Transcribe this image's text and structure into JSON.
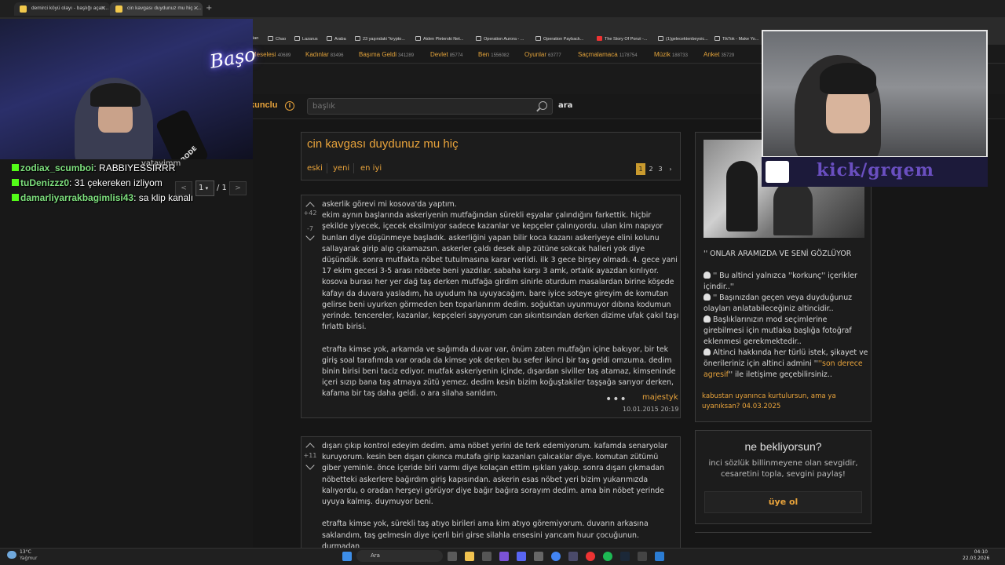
{
  "browser": {
    "tabs": [
      {
        "label": "demirci köyü olayı - başlığı açan..."
      },
      {
        "label": "cin kavgası duydunuz mu hiç - ..."
      }
    ],
    "bookmarks": [
      "ian",
      "Chao",
      "Lazarus",
      "Araba",
      "23 yaşındaki \"krypto...",
      "Aiden Pleterski Net...",
      "Operation Aurora - ...",
      "Operation Payback...",
      "The Story Of Ponzi -...",
      "(1)gelecektenbeyoic...",
      "TikTok - Make Yo..."
    ]
  },
  "site": {
    "categories": [
      {
        "name": "Meselesi",
        "count": "40689"
      },
      {
        "name": "Kadınlar",
        "count": "83496"
      },
      {
        "name": "Başıma Geldi",
        "count": "341289"
      },
      {
        "name": "Devlet",
        "count": "85774"
      },
      {
        "name": "Ben",
        "count": "1556082"
      },
      {
        "name": "Oyunlar",
        "count": "63777"
      },
      {
        "name": "Saçmalamaca",
        "count": "1178754"
      },
      {
        "name": "Müzik",
        "count": "188733"
      },
      {
        "name": "Anket",
        "count": "35729"
      }
    ],
    "logo_fragment": "kunclu",
    "search_placeholder": "başlık",
    "search_button": "ara"
  },
  "left": {
    "pager_prev": "<",
    "pager_current": "1",
    "pager_total": "/ 1",
    "pager_next": ">",
    "partial_a": "er",
    "partial_b": "yatayimm"
  },
  "topic": {
    "title": "cin kavgası duydunuz mu hiç",
    "sort": [
      "eski",
      "yeni",
      "en iyi"
    ],
    "pages": [
      "1",
      "2",
      "3",
      "›"
    ]
  },
  "entries": [
    {
      "votes_up": "+42",
      "votes_down": "-7",
      "text": "askerlik görevi mi kosova'da yaptım.\nekim aynın başlarında askeriyenin mutfağından sürekli eşyalar çalındığını farkettik. hiçbir şekilde yiyecek, içecek eksilmiyor sadece kazanlar ve kepçeler çalınıyordu. ulan kim napıyor bunları diye düşünmeye başladık. askerliğini yapan bilir koca kazanı askeriyeye elini kolunu sallayarak girip alıp çıkamazsın. askerler çaldı desek alıp zütüne sokcak halleri yok diye düşündük. sonra mutfakta nöbet tutulmasına karar verildi. ilk 3 gece birşey olmadı. 4. gece yani 17 ekim gecesi 3-5 arası nöbete beni yazdılar. sabaha karşı 3 amk, ortalık ayazdan kırılıyor. kosova burası her yer dağ taş derken mutfağa girdim sinirle oturdum masalardan birine köşede kafayı da duvara yasladım, ha uyudum ha uyuyacağım. bare iyice soteye gireyim de komutan gelirse beni uyurken görmeden ben toparlanırım dedim. soğuktan uyunmuyor dıbına kodumun yerinde. tencereler, kazanlar, kepçeleri sayıyorum can sıkıntısından derken dizime ufak çakıl taşı fırlattı birisi.\n\netrafta kimse yok, arkamda ve sağımda duvar var, önüm zaten mutfağın içine bakıyor, bir tek giriş soal tarafımda var orada da kimse yok derken bu sefer ikinci bir taş geldi omzuma. dedim binin birisi beni taciz ediyor. mutfak askeriyenin içinde, dışardan siviller taş atamaz, kimseninde içeri sızıp bana taş atmaya zütü yemez. dedim kesin bizim koğuştakiler taşşağa sarıyor derken, kafama bir taş daha geldi. o ara silaha sarıldım.",
      "author": "majestyk",
      "date": "10.01.2015 20:19"
    },
    {
      "votes_up": "+11",
      "text": "dışarı çıkıp kontrol edeyim dedim. ama nöbet yerini de terk edemiyorum. kafamda senaryolar kuruyorum. kesin ben dışarı çıkınca mutafa girip kazanları çalıcaklar diye. komutan zütümü giber yeminle. önce içeride biri varmı diye kolaçan ettim ışıkları yakıp. sonra dışarı çıkmadan nöbetteki askerlere bağırdım giriş kapısından. askerin esas nöbet yeri bizim yukarımızda kalıyordu, o oradan herşeyi görüyor diye bağır bağıra sorayım dedim. ama bin nöbet yerinde uyuya kalmış. duymuyor beni.\n\netrafta kimse yok, sürekli taş atıyo birileri ama kim atıyo göremiyorum. duvarın arkasına saklandım, taş gelmesin diye içerli biri girse silahla ensesini yarıcam huur çocuğunun. durmadan"
    }
  ],
  "sidebar": {
    "headline": "'' ONLAR ARAMIZDA VE SENİ GÖZLÜYOR",
    "line1": "'' Bu altinci yalnızca ''korkunç'' içerikler içindir..''",
    "line2": "'' Başınızdan geçen veya duyduğunuz olayları anlatabileceğiniz altincidir..",
    "line3": "Başlıklarınızın mod seçimlerine girebilmesi için mutlaka başlığa fotoğraf eklenmesi gerekmektedir..",
    "line4a": "Altinci hakkında her türlü istek, şikayet ve önerileriniz için altinci admini ''",
    "line4b": "''son derece agresif",
    "line4c": "'' ile iletişime geçebilirsiniz..",
    "footer": "kabustan uyanınca kurtulursun, ama ya uyanıksan? 04.03.2025",
    "signup_title": "ne bekliyorsun?",
    "signup_text": "inci sözlük billinmeyene olan sevgidir, cesaretini topla, sevgini paylaş!",
    "signup_button": "üye ol"
  },
  "stream": {
    "neon_sign": "Başo",
    "mic_brand": "RODE",
    "chat": [
      {
        "user": "zodiax_scumboi",
        "msg": "RABBIYESSIRRR"
      },
      {
        "user": "tuDenizzz0",
        "msg": "31 çekereken izliyom"
      },
      {
        "user": "damarliyarrakbagimlisi43",
        "msg": "sa klip kanalı"
      }
    ],
    "kick_channel": "kick/grqem"
  },
  "taskbar": {
    "weather_temp": "13°C",
    "weather_desc": "Yağmur",
    "search": "Ara",
    "time": "04:10",
    "date": "22.03.2026"
  }
}
